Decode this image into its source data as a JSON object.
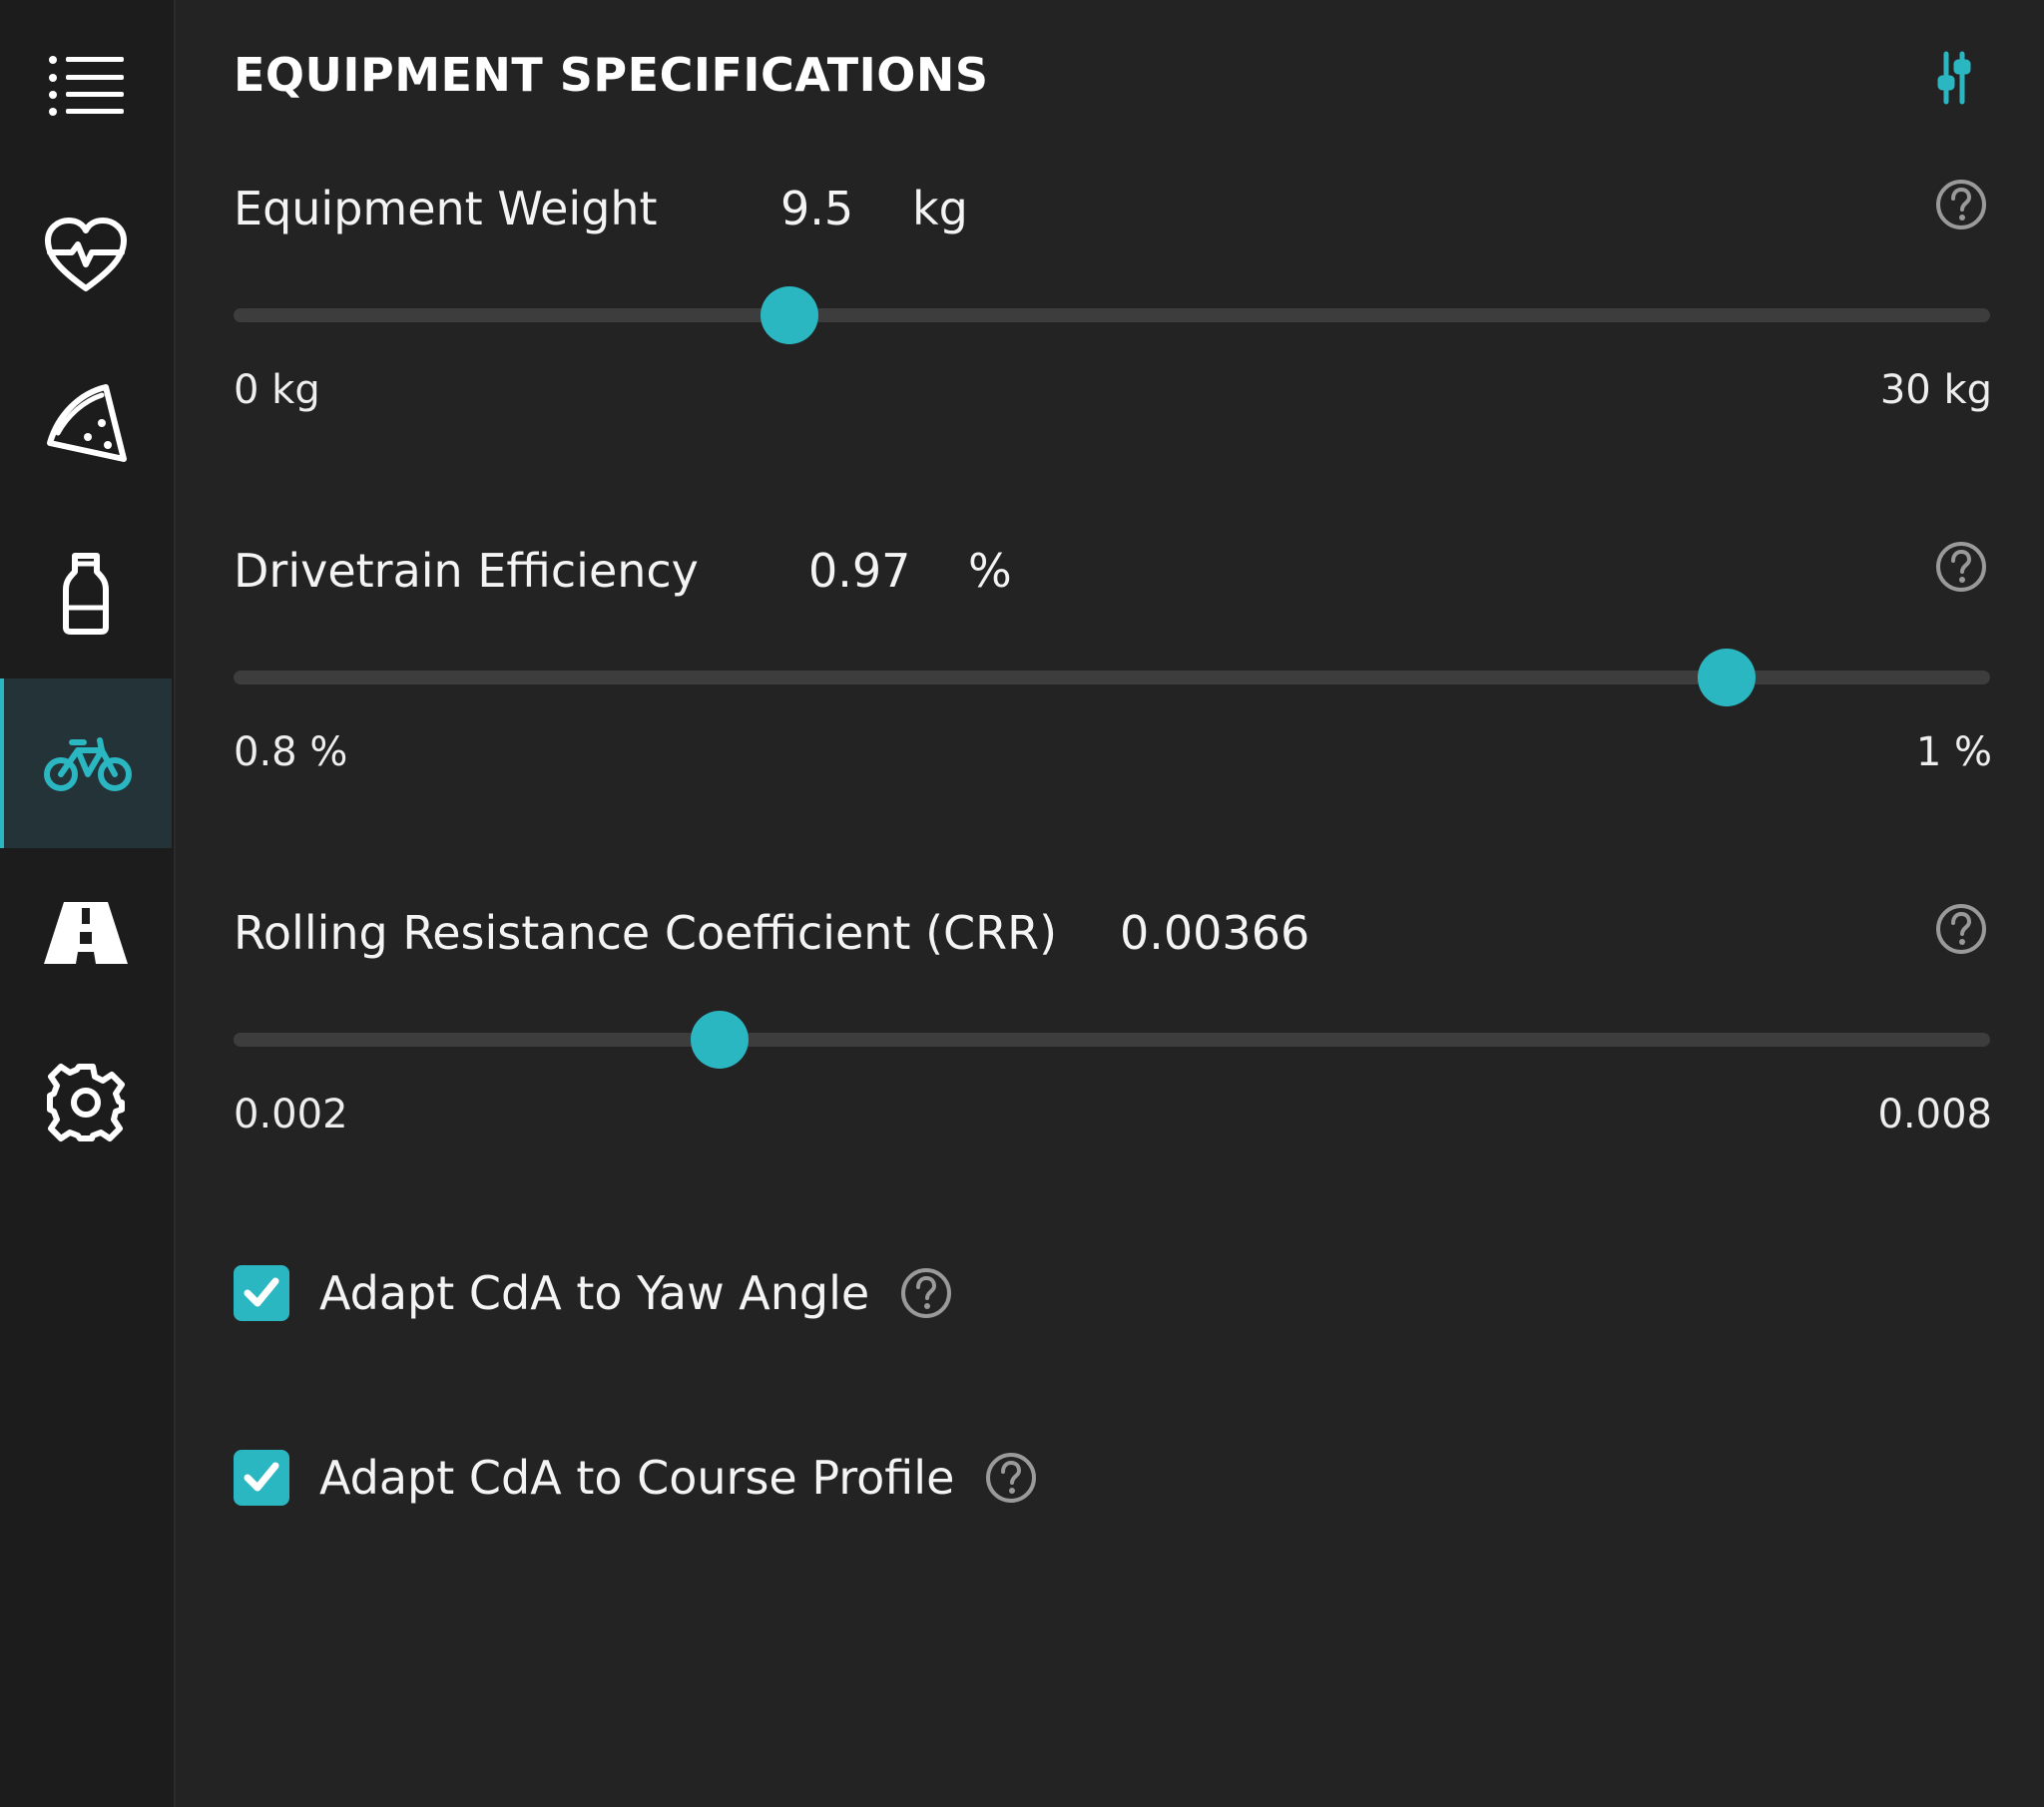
{
  "sidebar": {
    "items": [
      {
        "icon": "list-menu-icon"
      },
      {
        "icon": "heart-rate-icon"
      },
      {
        "icon": "pizza-slice-icon"
      },
      {
        "icon": "bottle-icon"
      },
      {
        "icon": "bicycle-icon",
        "active": true
      },
      {
        "icon": "road-icon"
      },
      {
        "icon": "gear-icon"
      }
    ]
  },
  "header": {
    "title": "EQUIPMENT SPECIFICATIONS",
    "action_icon": "sliders-icon"
  },
  "settings": {
    "weight": {
      "label": "Equipment Weight",
      "value": "9.5",
      "unit": "kg",
      "min_label": "0 kg",
      "max_label": "30 kg",
      "min": 0,
      "max": 30,
      "current": 9.5
    },
    "drivetrain": {
      "label": "Drivetrain Efficiency",
      "value": "0.97",
      "unit": "%",
      "min_label": "0.8 %",
      "max_label": "1 %",
      "min": 0.8,
      "max": 1,
      "current": 0.97
    },
    "crr": {
      "label": "Rolling Resistance Coefficient (CRR)",
      "value": "0.00366",
      "min_label": "0.002",
      "max_label": "0.008",
      "min": 0.002,
      "max": 0.008,
      "current": 0.00366
    }
  },
  "checkboxes": {
    "yaw": {
      "label": "Adapt CdA to Yaw Angle",
      "checked": true
    },
    "profile": {
      "label": "Adapt CdA to Course Profile",
      "checked": true
    }
  },
  "colors": {
    "accent": "#2bb7c1",
    "background": "#232323",
    "sidebar": "#1c1c1c",
    "track": "#3d3d3d"
  }
}
